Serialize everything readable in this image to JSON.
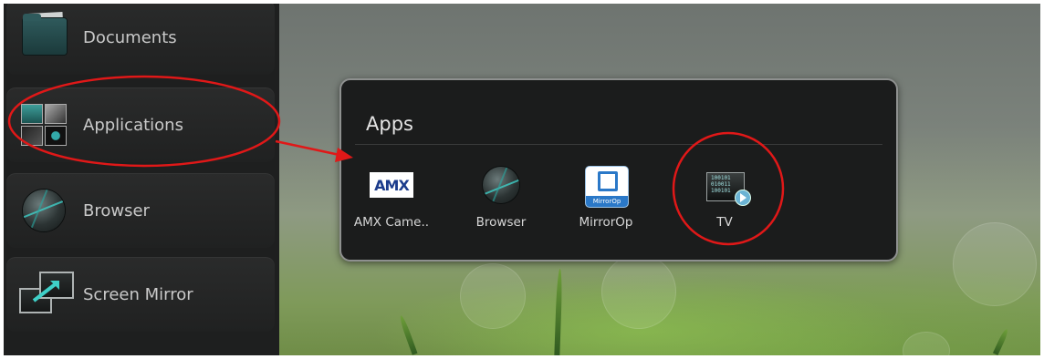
{
  "sidebar": {
    "items": [
      {
        "label": "Documents",
        "icon": "documents-folder-icon"
      },
      {
        "label": "Applications",
        "icon": "applications-grid-icon"
      },
      {
        "label": "Browser",
        "icon": "browser-globe-icon"
      },
      {
        "label": "Screen Mirror",
        "icon": "screen-mirror-icon"
      }
    ]
  },
  "dialog": {
    "title": "Apps",
    "apps": [
      {
        "label": "AMX Came..",
        "icon": "amx-camera-icon",
        "icon_text": "AMX"
      },
      {
        "label": "Browser",
        "icon": "browser-globe-icon"
      },
      {
        "label": "MirrorOp",
        "icon": "mirrorop-icon",
        "icon_text": "MirrorOp"
      },
      {
        "label": "TV",
        "icon": "tv-icon"
      }
    ]
  },
  "annotations": {
    "color": "#e01818",
    "highlighted": [
      "Applications",
      "TV"
    ]
  },
  "colors": {
    "sidebar_bg": "#1e1f1f",
    "dialog_bg": "#1b1c1c",
    "accent_teal": "#3fd0c8",
    "mirrorop_blue": "#2a78c8"
  }
}
